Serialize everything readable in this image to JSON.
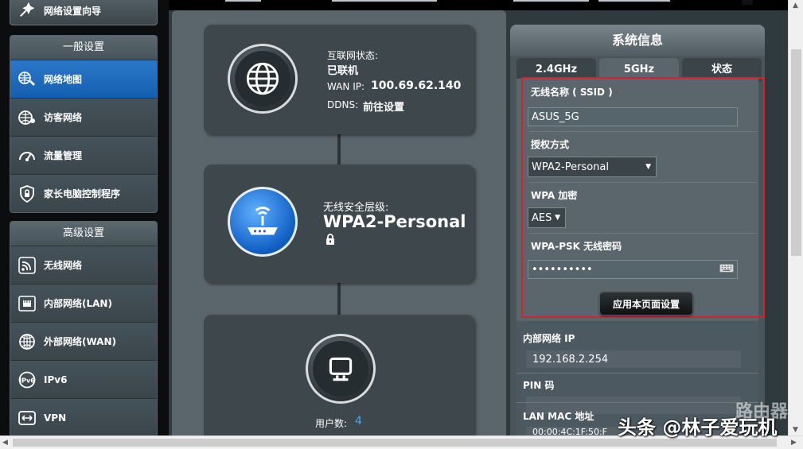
{
  "sidebar": {
    "wizard_label": "网络设置向导",
    "general_title": "一般设置",
    "general_items": [
      {
        "label": "网络地图",
        "icon": "network-map-icon"
      },
      {
        "label": "访客网络",
        "icon": "guest-network-icon"
      },
      {
        "label": "流量管理",
        "icon": "traffic-gauge-icon"
      },
      {
        "label": "家长电脑控制程序",
        "icon": "parental-shield-icon"
      }
    ],
    "advanced_title": "高级设置",
    "advanced_items": [
      {
        "label": "无线网络",
        "icon": "wireless-icon"
      },
      {
        "label": "内部网络(LAN)",
        "icon": "lan-icon"
      },
      {
        "label": "外部网络(WAN)",
        "icon": "wan-globe-icon"
      },
      {
        "label": "IPv6",
        "icon": "ipv6-icon"
      },
      {
        "label": "VPN",
        "icon": "vpn-icon"
      }
    ]
  },
  "map": {
    "internet": {
      "status_label": "互联网状态:",
      "status_value": "已联机",
      "wan_ip_label": "WAN IP:",
      "wan_ip_value": "100.69.62.140",
      "ddns_label": "DDNS:",
      "ddns_value": "前往设置"
    },
    "router": {
      "security_label": "无线安全层级:",
      "security_value": "WPA2-Personal"
    },
    "clients": {
      "count_label": "用户数:",
      "count_value": "4"
    }
  },
  "info": {
    "title": "系统信息",
    "tabs": [
      "2.4GHz",
      "5GHz",
      "状态"
    ],
    "active_tab": "5GHz",
    "ssid_label": "无线名称 ( SSID )",
    "ssid_value": "ASUS_5G",
    "auth_label": "授权方式",
    "auth_value": "WPA2-Personal",
    "wpa_label": "WPA 加密",
    "wpa_value": "AES",
    "psk_label": "WPA-PSK 无线密码",
    "psk_value": "••••••••••",
    "apply_label": "应用本页面设置",
    "lan_ip_label": "内部网络 IP",
    "lan_ip_value": "192.168.2.254",
    "pin_label": "PIN 码",
    "mac_label": "LAN MAC 地址",
    "mac_value": "00:00:4C:1F:50:F"
  },
  "watermark": {
    "line1": "路由器",
    "line2": "头条 @林子爱玩机"
  },
  "colors": {
    "active_blue": "#1f6cc0",
    "highlight_red": "#d5232a",
    "client_count": "#4aa3ff"
  }
}
